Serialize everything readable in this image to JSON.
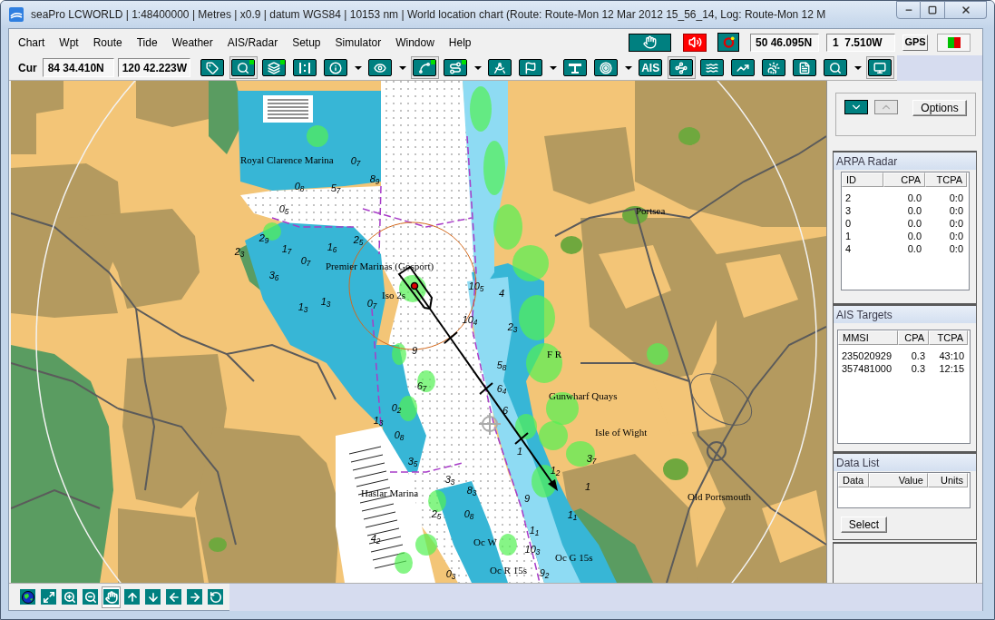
{
  "window": {
    "title": "seaPro LCWORLD | 1:48400000 | Metres | x0.9 | datum WGS84 | 10153 nm | World location chart (Route: Route-Mon 12 Mar 2012 15_56_14, Log: Route-Mon 12 M"
  },
  "menu": [
    "Chart",
    "Wpt",
    "Route",
    "Tide",
    "Weather",
    "AIS/Radar",
    "Setup",
    "Simulator",
    "Window",
    "Help"
  ],
  "position": {
    "latitude": "50 46.095N",
    "longitude": "1  7.510W",
    "gps_button": "GPS"
  },
  "cursor": {
    "label": "Cur",
    "latitude": "84 34.410N",
    "longitude": "120 42.223W"
  },
  "toolbar": [
    {
      "kind": "tool",
      "pressed": false,
      "indicator": false
    },
    {
      "kind": "tool",
      "pressed": true,
      "indicator": true
    },
    {
      "kind": "tool",
      "pressed": false,
      "indicator": true
    },
    {
      "kind": "tool",
      "pressed": false,
      "indicator": false
    },
    {
      "kind": "tool",
      "pressed": false,
      "indicator": false
    },
    {
      "kind": "arrow"
    },
    {
      "kind": "tool",
      "pressed": false,
      "indicator": false
    },
    {
      "kind": "arrow"
    },
    {
      "kind": "tool",
      "pressed": true,
      "indicator": true
    },
    {
      "kind": "tool",
      "pressed": false,
      "indicator": true
    },
    {
      "kind": "arrow"
    },
    {
      "kind": "tool",
      "pressed": false,
      "indicator": false
    },
    {
      "kind": "tool",
      "pressed": false,
      "indicator": false
    },
    {
      "kind": "arrow"
    },
    {
      "kind": "tool",
      "pressed": false,
      "indicator": false
    },
    {
      "kind": "tool",
      "pressed": false,
      "indicator": false
    },
    {
      "kind": "arrow"
    },
    {
      "kind": "text",
      "label": "AIS",
      "pressed": false
    },
    {
      "kind": "tool",
      "pressed": true,
      "indicator": false
    },
    {
      "kind": "tool",
      "pressed": false,
      "indicator": false
    },
    {
      "kind": "tool",
      "pressed": false,
      "indicator": false
    },
    {
      "kind": "tool",
      "pressed": false,
      "indicator": false
    },
    {
      "kind": "tool",
      "pressed": false,
      "indicator": false
    },
    {
      "kind": "tool",
      "pressed": false,
      "indicator": false
    },
    {
      "kind": "arrow"
    },
    {
      "kind": "tool",
      "pressed": true,
      "indicator": false
    }
  ],
  "map": {
    "places": [
      "Royal Clarence Marina",
      "Premier Marinas (Gosport)",
      "Portsea",
      "Gunwharf Quays",
      "Isle of Wight",
      "Old Portsmouth",
      "Haslar Marina"
    ],
    "lights": [
      "Iso 2s",
      "F R",
      "Oc W",
      "Oc R 15s",
      "Oc G 15s"
    ],
    "soundings": [
      "8$_{9}$",
      "0$_{8}$",
      "5$_{7}$",
      "0$_{7}$",
      "0$_{5}$",
      "2$_{9}$",
      "1$_{7}$",
      "1$_{6}$",
      "2$_{5}$",
      "0$_{7}$",
      "3$_{6}$",
      "1$_{3}$",
      "1$_{3}$",
      "0$_{7}$",
      "10$_{5}$",
      "10$_{4}$",
      "4",
      "2$_{3}$",
      "9",
      "2$_{3}$",
      "5$_{8}$",
      "6$_{4}$",
      "6",
      "0$_{2}$",
      "6$_{7}$",
      "0$_{8}$",
      "1$_{3}$",
      "3$_{5}$",
      "3$_{3}$",
      "8$_{3}$",
      "2$_{5}$",
      "0$_{8}$",
      "4$_{2}$",
      "1$_{2}$",
      "3$_{7}$",
      "1$_{1}$",
      "1$_{1}$",
      "10$_{3}$",
      "9$_{2}$",
      "0$_{3}$",
      "1",
      "1",
      "9"
    ]
  },
  "panel": {
    "collapse_buttons": [
      {
        "enabled": true
      },
      {
        "enabled": false
      }
    ],
    "options_button": "Options",
    "arpa_radar": {
      "title": "ARPA Radar",
      "columns": [
        "ID",
        "CPA",
        "TCPA"
      ],
      "rows": [
        [
          "2",
          "0.0",
          "0:0"
        ],
        [
          "3",
          "0.0",
          "0:0"
        ],
        [
          "0",
          "0.0",
          "0:0"
        ],
        [
          "1",
          "0.0",
          "0:0"
        ],
        [
          "4",
          "0.0",
          "0:0"
        ]
      ]
    },
    "ais_targets": {
      "title": "AIS Targets",
      "columns": [
        "MMSI",
        "CPA",
        "TCPA"
      ],
      "rows": [
        [
          "235020929",
          "0.3",
          "43:10"
        ],
        [
          "357481000",
          "0.3",
          "12:15"
        ]
      ]
    },
    "data_list": {
      "title": "Data List",
      "columns": [
        "Data",
        "Value",
        "Units"
      ],
      "select_button": "Select"
    }
  },
  "navigation_toolbar": [
    {
      "pressed": false
    },
    {
      "pressed": false
    },
    {
      "pressed": false
    },
    {
      "pressed": false
    },
    {
      "pressed": true
    },
    {
      "pressed": false
    },
    {
      "pressed": false
    },
    {
      "pressed": false
    },
    {
      "pressed": false
    },
    {
      "pressed": false
    }
  ]
}
